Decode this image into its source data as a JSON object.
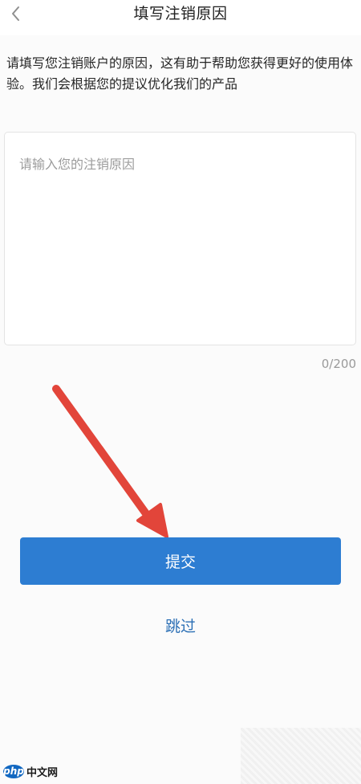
{
  "header": {
    "back_icon": "chevron-left-icon",
    "title": "填写注销原因"
  },
  "description": "请填写您注销账户的原因，这有助于帮助您获得更好的使用体验。我们会根据您的提议优化我们的产品",
  "reason_input": {
    "value": "",
    "placeholder": "请输入您的注销原因"
  },
  "char_counter": "0/200",
  "buttons": {
    "submit_label": "提交",
    "skip_label": "跳过"
  },
  "watermark": {
    "logo_text": "php",
    "site_text": "中文网"
  },
  "colors": {
    "primary_button": "#2d7dd2",
    "skip_link": "#2b6fb5",
    "annotation_arrow": "#e2453a"
  }
}
